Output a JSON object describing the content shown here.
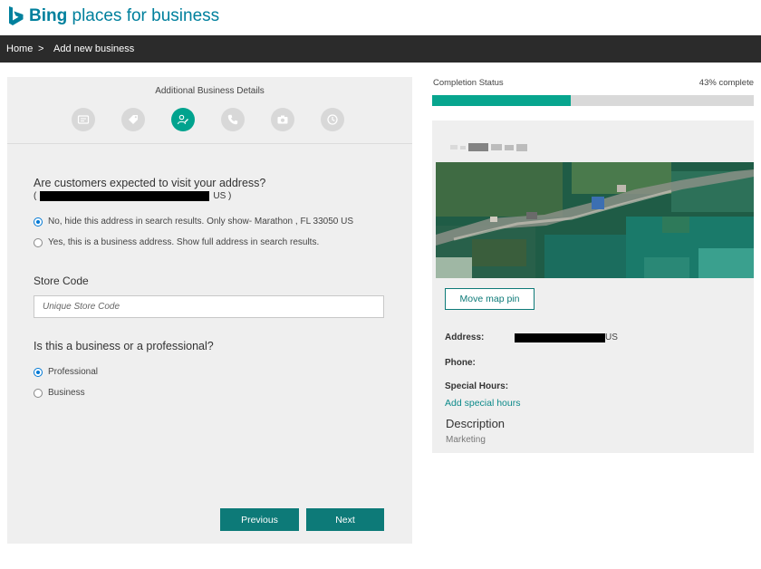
{
  "brand": {
    "bold": "Bing",
    "rest": " places for business",
    "color": "#00809d"
  },
  "breadcrumb": {
    "home": "Home",
    "separator": ">",
    "current": "Add new business"
  },
  "wizard": {
    "step_title": "Additional Business Details",
    "steps": [
      {
        "icon": "id-card-icon",
        "active": false
      },
      {
        "icon": "tag-icon",
        "active": false
      },
      {
        "icon": "user-edit-icon",
        "active": true
      },
      {
        "icon": "phone-icon",
        "active": false
      },
      {
        "icon": "camera-icon",
        "active": false
      },
      {
        "icon": "clock-icon",
        "active": false
      }
    ],
    "visit_question": "Are customers expected to visit your address?",
    "address_open": "(",
    "address_suffix": "US )",
    "option_hide": "No, hide this address in search results. Only show- Marathon , FL 33050 US",
    "option_show": "Yes, this is a business address. Show full address in search results.",
    "store_code_label": "Store Code",
    "store_code_placeholder": "Unique Store Code",
    "type_question": "Is this a business or a professional?",
    "option_professional": "Professional",
    "option_business": "Business",
    "previous": "Previous",
    "next": "Next"
  },
  "completion": {
    "label": "Completion Status",
    "percent_text": "43% complete",
    "percent": 43,
    "accent": "#07a58e"
  },
  "card": {
    "move_pin": "Move map pin",
    "address_label": "Address:",
    "address_suffix": "US",
    "phone_label": "Phone:",
    "special_hours_label": "Special Hours:",
    "add_special_hours": "Add special hours",
    "description_title": "Description",
    "description_value": "Marketing"
  },
  "colors": {
    "primary_button": "#0d7a78",
    "nav_bg": "#2b2b2b",
    "panel_bg": "#efefef"
  }
}
